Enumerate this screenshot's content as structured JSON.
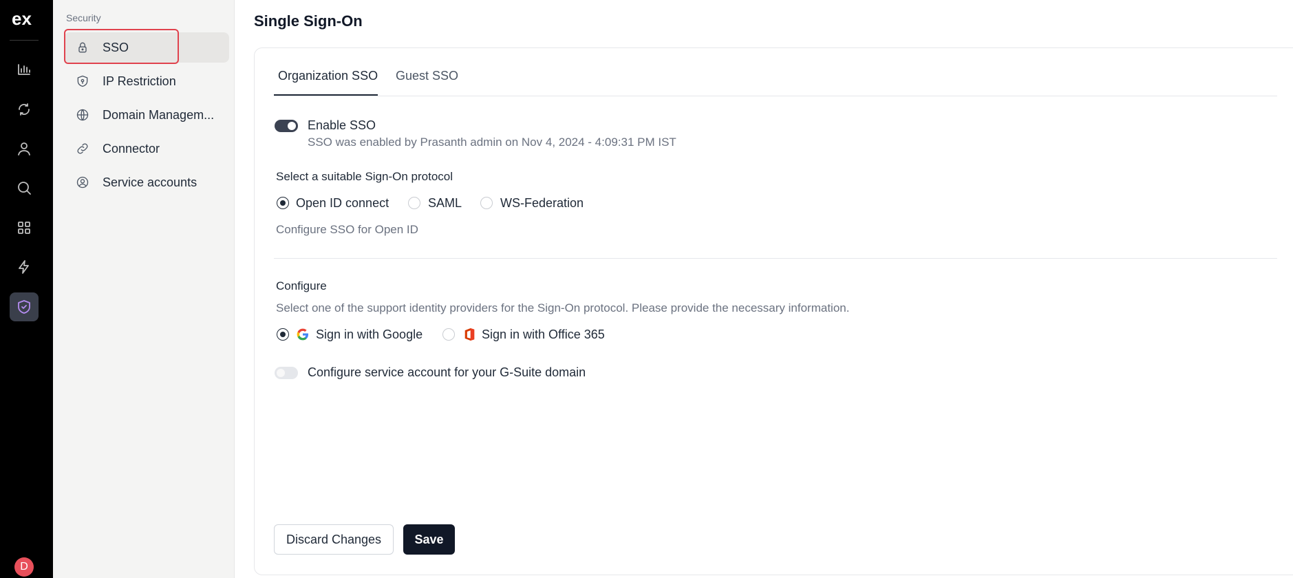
{
  "app": {
    "logo_text": "ex"
  },
  "rail": {
    "icons": [
      "analytics-icon",
      "loop-icon",
      "user-icon",
      "search-icon",
      "apps-grid-icon",
      "lightning-icon",
      "shield-icon"
    ],
    "avatar_initial": "D",
    "avatar_color": "#e8505b"
  },
  "sidebar": {
    "section": "Security",
    "items": [
      {
        "label": "SSO",
        "icon": "lock-icon"
      },
      {
        "label": "IP Restriction",
        "icon": "shield-icon"
      },
      {
        "label": "Domain Managem...",
        "icon": "globe-icon"
      },
      {
        "label": "Connector",
        "icon": "link-icon"
      },
      {
        "label": "Service accounts",
        "icon": "user-circle-icon"
      }
    ]
  },
  "page": {
    "title": "Single Sign-On"
  },
  "tabs": [
    {
      "label": "Organization SSO"
    },
    {
      "label": "Guest SSO"
    }
  ],
  "enable_sso": {
    "label": "Enable SSO",
    "status": "SSO was enabled by Prasanth admin on Nov 4, 2024 - 4:09:31 PM IST",
    "enabled": true
  },
  "protocol": {
    "heading": "Select a suitable Sign-On protocol",
    "options": [
      "Open ID connect",
      "SAML",
      "WS-Federation"
    ],
    "selected": "Open ID connect",
    "hint": "Configure SSO for Open ID"
  },
  "configure": {
    "heading": "Configure",
    "description": "Select one of the support identity providers for the Sign-On protocol. Please provide the necessary information.",
    "providers": [
      {
        "label": "Sign in with Google",
        "icon": "google-icon"
      },
      {
        "label": "Sign in with Office 365",
        "icon": "office365-icon"
      }
    ],
    "selected": "Sign in with Google",
    "service_account_label": "Configure service account for your G-Suite domain",
    "service_account_enabled": false
  },
  "actions": {
    "discard_label": "Discard Changes",
    "save_label": "Save"
  },
  "colors": {
    "primary": "#111827",
    "accent_highlight": "#e0424d",
    "toggle_on": "#3b4252"
  }
}
